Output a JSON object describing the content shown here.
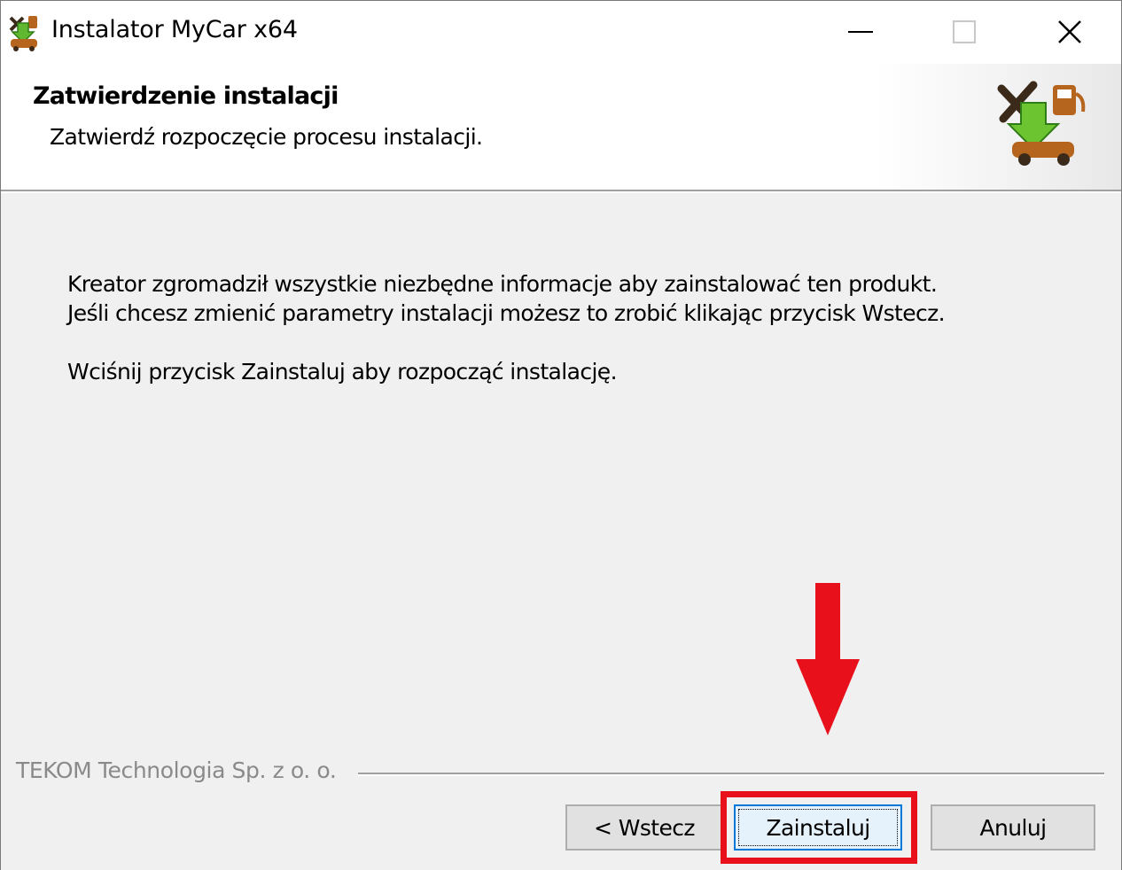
{
  "window": {
    "title": "Instalator MyCar x64",
    "controls": {
      "minimize": "minimize-icon",
      "maximize": "maximize-icon",
      "close": "close-icon"
    }
  },
  "header": {
    "title": "Zatwierdzenie instalacji",
    "subtitle": "Zatwierdź rozpoczęcie procesu instalacji."
  },
  "body": {
    "line1": "Kreator zgromadził wszystkie niezbędne informacje aby zainstalować ten produkt.",
    "line2": "Jeśli chcesz zmienić parametry instalacji możesz to zrobić klikając przycisk Wstecz.",
    "line3": "Wciśnij przycisk Zainstaluj aby rozpocząć instalację."
  },
  "footer": {
    "branding": "TEKOM Technologia Sp. z o. o.",
    "buttons": {
      "back": "< Wstecz",
      "install": "Zainstaluj",
      "cancel": "Anuluj"
    }
  },
  "annotation": {
    "arrow_color": "#e8101a",
    "highlight_color": "#e8101a",
    "icon": "down-arrow-icon"
  },
  "colors": {
    "focus_border": "#0078d7",
    "dialog_bg": "#f0f0f0"
  }
}
